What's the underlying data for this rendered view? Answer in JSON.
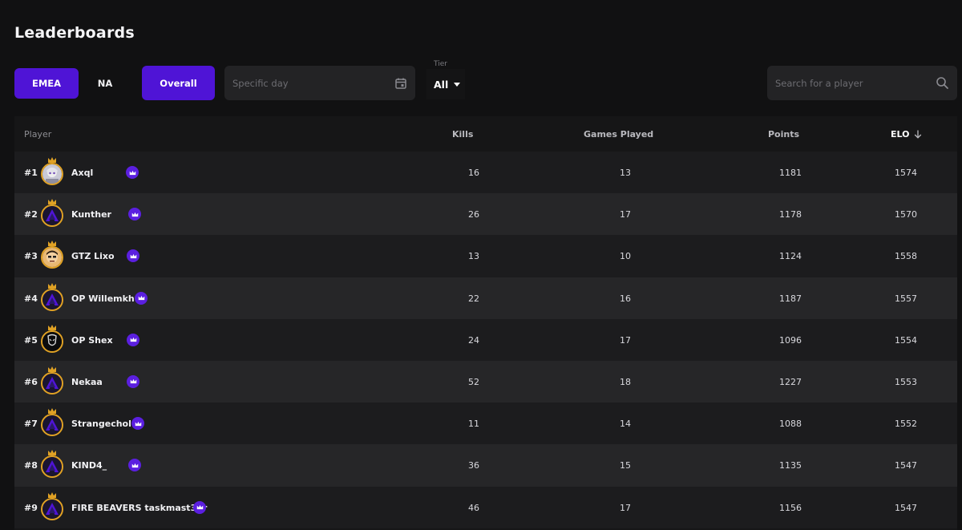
{
  "page": {
    "title": "Leaderboards"
  },
  "filters": {
    "regions": [
      {
        "label": "EMEA",
        "active": true
      },
      {
        "label": "NA",
        "active": false
      }
    ],
    "overall_label": "Overall",
    "date_placeholder": "Specific day",
    "tier_label": "Tier",
    "tier_value": "All",
    "search_placeholder": "Search for a player"
  },
  "table": {
    "columns": {
      "player": "Player",
      "kills": "Kills",
      "games": "Games Played",
      "points": "Points",
      "elo": "ELO"
    },
    "rows": [
      {
        "rank": "#1",
        "name": "Axql",
        "kills": "16",
        "games": "13",
        "points": "1181",
        "elo": "1574",
        "avatar": "photo-silver"
      },
      {
        "rank": "#2",
        "name": "Kunther",
        "kills": "26",
        "games": "17",
        "points": "1178",
        "elo": "1570",
        "avatar": "logo"
      },
      {
        "rank": "#3",
        "name": "GTZ Lixo",
        "kills": "13",
        "games": "10",
        "points": "1124",
        "elo": "1558",
        "avatar": "photo-face"
      },
      {
        "rank": "#4",
        "name": "OP Willemkh",
        "kills": "22",
        "games": "16",
        "points": "1187",
        "elo": "1557",
        "avatar": "logo"
      },
      {
        "rank": "#5",
        "name": "OP Shex",
        "kills": "24",
        "games": "17",
        "points": "1096",
        "elo": "1554",
        "avatar": "photo-dark"
      },
      {
        "rank": "#6",
        "name": "Nekaa",
        "kills": "52",
        "games": "18",
        "points": "1227",
        "elo": "1553",
        "avatar": "logo"
      },
      {
        "rank": "#7",
        "name": "Strangechol",
        "kills": "11",
        "games": "14",
        "points": "1088",
        "elo": "1552",
        "avatar": "logo"
      },
      {
        "rank": "#8",
        "name": "KIND4_",
        "kills": "36",
        "games": "15",
        "points": "1135",
        "elo": "1547",
        "avatar": "logo"
      },
      {
        "rank": "#9",
        "name": "FIRE BEAVERS taskmast33r",
        "kills": "46",
        "games": "17",
        "points": "1156",
        "elo": "1547",
        "avatar": "logo"
      }
    ]
  },
  "colors": {
    "accent": "#4f14d6",
    "badge": "#5b1fe0",
    "gold": "#e1a224",
    "background": "#111112"
  },
  "icons": {
    "date": "calendar-icon",
    "search": "search-icon",
    "sort": "arrow-down-icon",
    "badge": "crown-icon"
  }
}
